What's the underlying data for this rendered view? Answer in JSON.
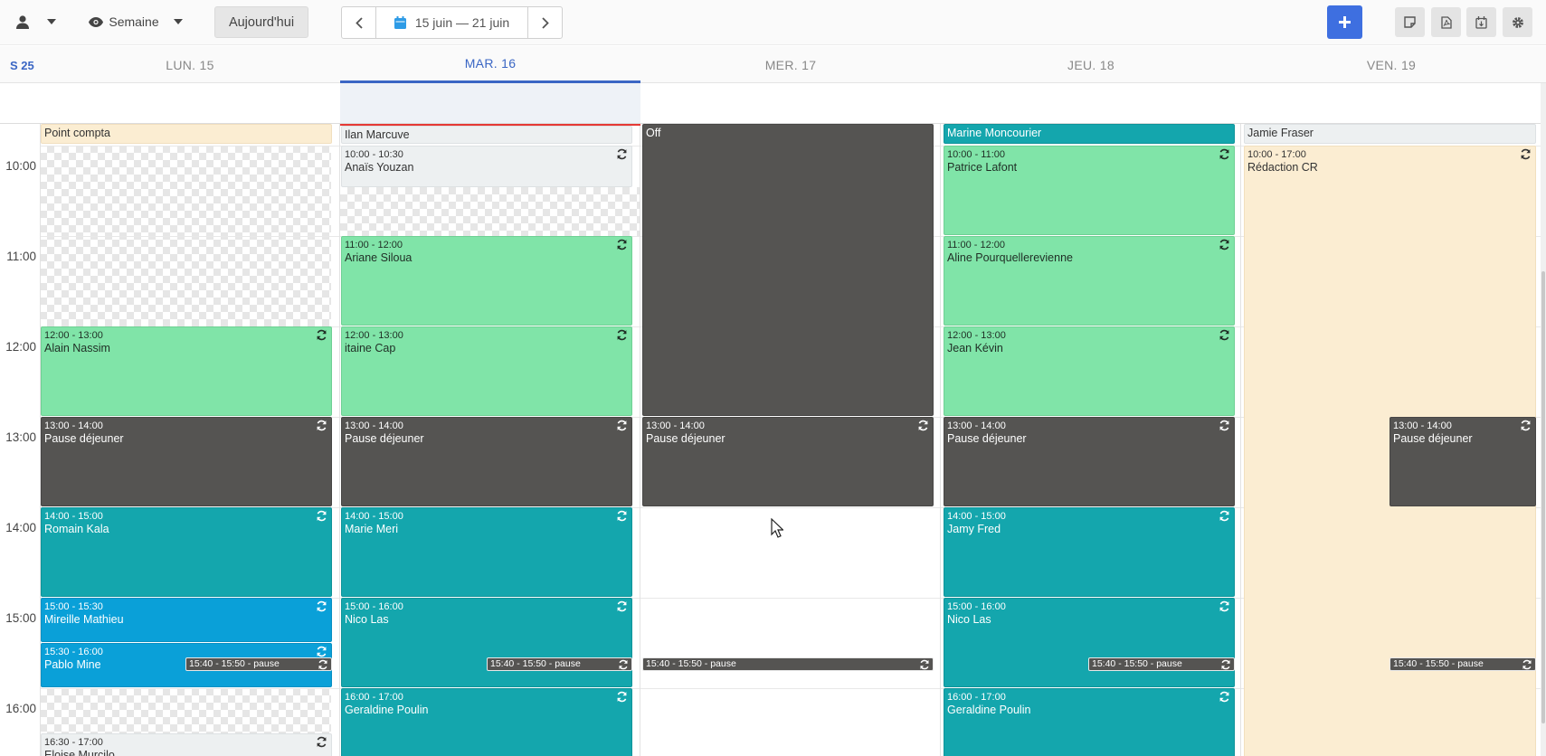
{
  "toolbar": {
    "view_label": "Semaine",
    "today_label": "Aujourd'hui",
    "date_range": "15 juin — 21 juin"
  },
  "header": {
    "week_number": "S 25",
    "days": [
      {
        "label": "LUN. 15"
      },
      {
        "label": "MAR. 16"
      },
      {
        "label": "MER. 17"
      },
      {
        "label": "JEU. 18"
      },
      {
        "label": "VEN. 19"
      }
    ]
  },
  "hours": [
    "10:00",
    "11:00",
    "12:00",
    "13:00",
    "14:00",
    "15:00",
    "16:00"
  ],
  "events": {
    "mon": [
      {
        "name": "Point compta"
      },
      {
        "time": "12:00 - 13:00",
        "name": "Alain Nassim"
      },
      {
        "time": "13:00 - 14:00",
        "name": "Pause déjeuner"
      },
      {
        "time": "14:00 - 15:00",
        "name": "Romain Kala"
      },
      {
        "time": "15:00 - 15:30",
        "name": "Mireille Mathieu"
      },
      {
        "time": "15:30 - 16:00",
        "name": "Pablo Mine"
      },
      {
        "time": "16:30 - 17:00",
        "name": "Eloise Murcilo"
      }
    ],
    "tue": [
      {
        "name": "Ilan Marcuve"
      },
      {
        "time": "10:00 - 10:30",
        "name": "Anaïs Youzan"
      },
      {
        "time": "11:00 - 12:00",
        "name": "Ariane Siloua"
      },
      {
        "time": "12:00 - 13:00",
        "name": "itaine Cap"
      },
      {
        "time": "13:00 - 14:00",
        "name": "Pause déjeuner"
      },
      {
        "time": "14:00 - 15:00",
        "name": "Marie Meri"
      },
      {
        "time": "15:00 - 16:00",
        "name": "Nico Las"
      },
      {
        "time": "16:00 - 17:00",
        "name": "Geraldine Poulin"
      }
    ],
    "wed": [
      {
        "name": "Off"
      },
      {
        "time": "13:00 - 14:00",
        "name": "Pause déjeuner"
      }
    ],
    "thu": [
      {
        "name": "Marine Moncourier"
      },
      {
        "time": "10:00 - 11:00",
        "name": "Patrice Lafont"
      },
      {
        "time": "11:00 - 12:00",
        "name": "Aline Pourquellerevienne"
      },
      {
        "time": "12:00 - 13:00",
        "name": "Jean Kévin"
      },
      {
        "time": "13:00 - 14:00",
        "name": "Pause déjeuner"
      },
      {
        "time": "14:00 - 15:00",
        "name": "Jamy Fred"
      },
      {
        "time": "15:00 - 16:00",
        "name": "Nico Las"
      },
      {
        "time": "16:00 - 17:00",
        "name": "Geraldine Poulin"
      }
    ],
    "fri": [
      {
        "name": "Jamie Fraser"
      },
      {
        "time": "10:00 - 17:00",
        "name": "Rédaction CR"
      },
      {
        "time": "13:00 - 14:00",
        "name": "Pause déjeuner"
      }
    ],
    "pause_label": "15:40 - 15:50 - pause"
  },
  "colors": {
    "green": "#80e4a8",
    "teal": "#14a6ad",
    "dark": "#555452",
    "blue": "#0aa0d8",
    "cream": "#fbedd2",
    "accent": "#3e6fe0",
    "today_text": "#3a66c4",
    "now_line": "#e53935"
  }
}
